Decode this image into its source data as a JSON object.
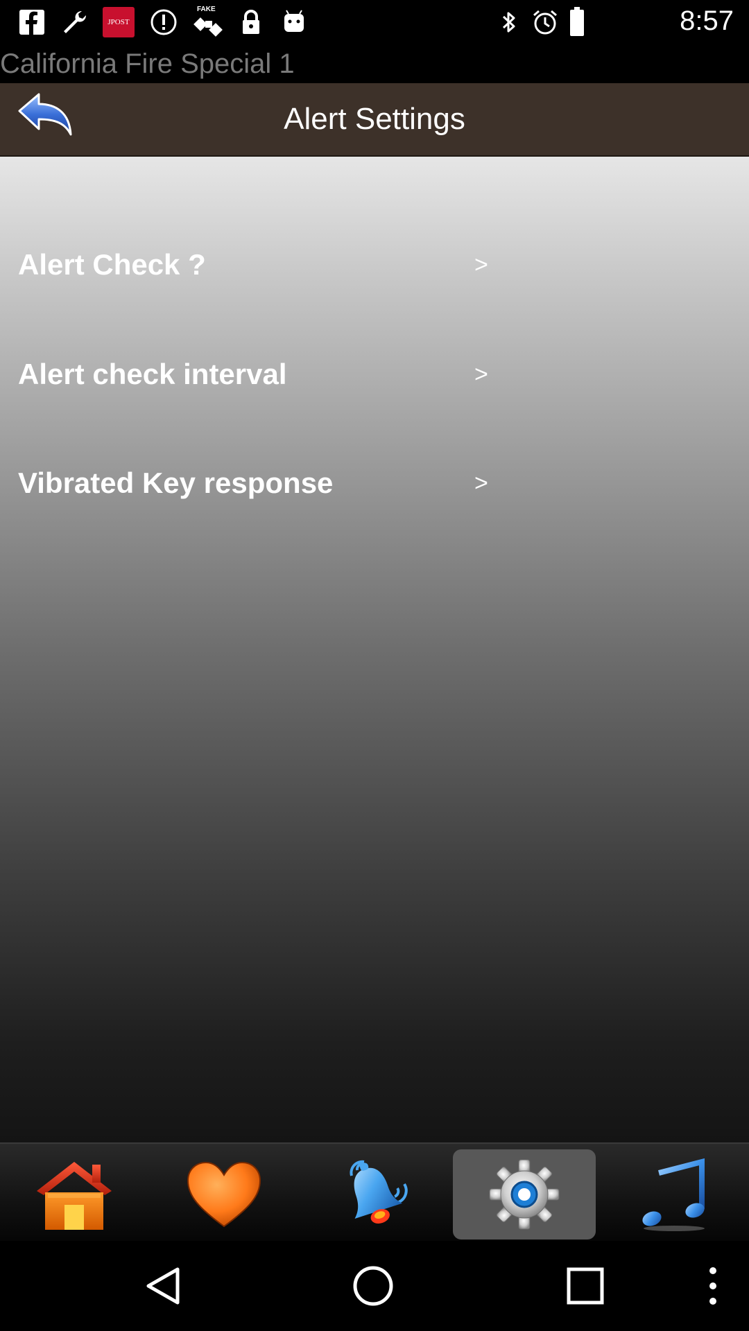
{
  "status_bar": {
    "time": "8:57",
    "left_icons": [
      "facebook-icon",
      "wrench-icon",
      "jpost-icon",
      "info-icon",
      "satellite-icon",
      "lock-icon",
      "android-icon"
    ],
    "jpost_label": "JPOST",
    "fake_label": "FAKE",
    "right_icons": [
      "bluetooth-icon",
      "alarm-icon",
      "battery-icon"
    ]
  },
  "app": {
    "title": "California Fire Special 1"
  },
  "header": {
    "title": "Alert Settings",
    "back_icon": "back-arrow-icon"
  },
  "settings": {
    "items": [
      {
        "label": "Alert Check  ?",
        "arrow": ">"
      },
      {
        "label": "Alert check interval",
        "arrow": ">"
      },
      {
        "label": "Vibrated Key response",
        "arrow": ">"
      }
    ]
  },
  "tabbar": {
    "tabs": [
      {
        "icon": "home-icon",
        "selected": false
      },
      {
        "icon": "heart-icon",
        "selected": false
      },
      {
        "icon": "bell-icon",
        "selected": false
      },
      {
        "icon": "gear-icon",
        "selected": true
      },
      {
        "icon": "music-note-icon",
        "selected": false
      }
    ]
  },
  "navbar": {
    "buttons": [
      "back-triangle-icon",
      "home-circle-icon",
      "recents-square-icon",
      "more-dots-icon"
    ]
  },
  "colors": {
    "header_bg": "#3d3129",
    "tab_selected_bg": "#585858",
    "back_arrow": "#3a6fd8"
  }
}
